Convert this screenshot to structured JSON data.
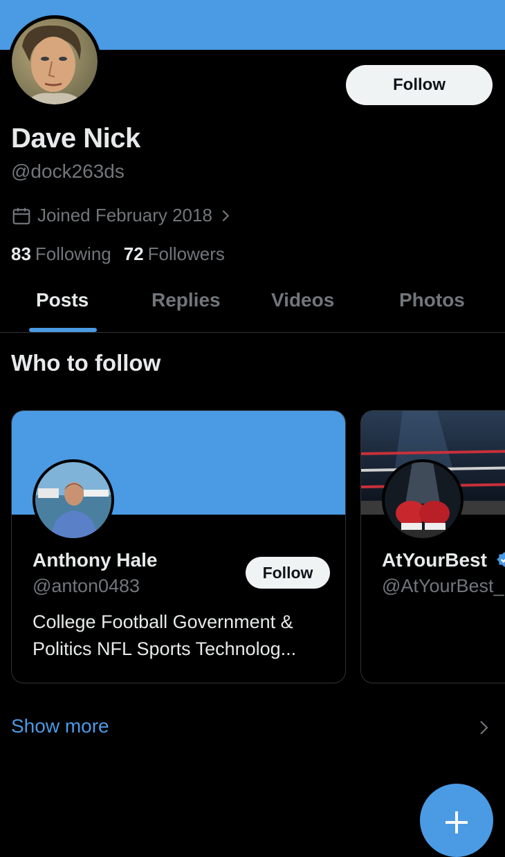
{
  "profile": {
    "name": "Dave Nick",
    "handle": "@dock263ds",
    "joined": "Joined February 2018",
    "following_count": "83",
    "following_label": "Following",
    "followers_count": "72",
    "followers_label": "Followers",
    "follow_label": "Follow"
  },
  "tabs": [
    {
      "label": "Posts",
      "active": true
    },
    {
      "label": "Replies",
      "active": false
    },
    {
      "label": "Videos",
      "active": false
    },
    {
      "label": "Photos",
      "active": false
    }
  ],
  "who_to_follow": {
    "title": "Who to follow",
    "cards": [
      {
        "name": "Anthony Hale",
        "handle": "@anton0483",
        "bio": "College Football Government & Politics NFL Sports Technolog...",
        "follow_label": "Follow"
      },
      {
        "name": "AtYourBest",
        "handle": "@AtYourBest_",
        "verified": true
      }
    ],
    "show_more": "Show more"
  },
  "icons": {
    "calendar": "calendar-icon",
    "chevron": "chevron-right-icon",
    "compose": "plus-icon",
    "verified": "verified-badge-icon"
  },
  "colors": {
    "accent": "#4b9ae4",
    "background": "#000000",
    "secondary_text": "#71767b"
  }
}
